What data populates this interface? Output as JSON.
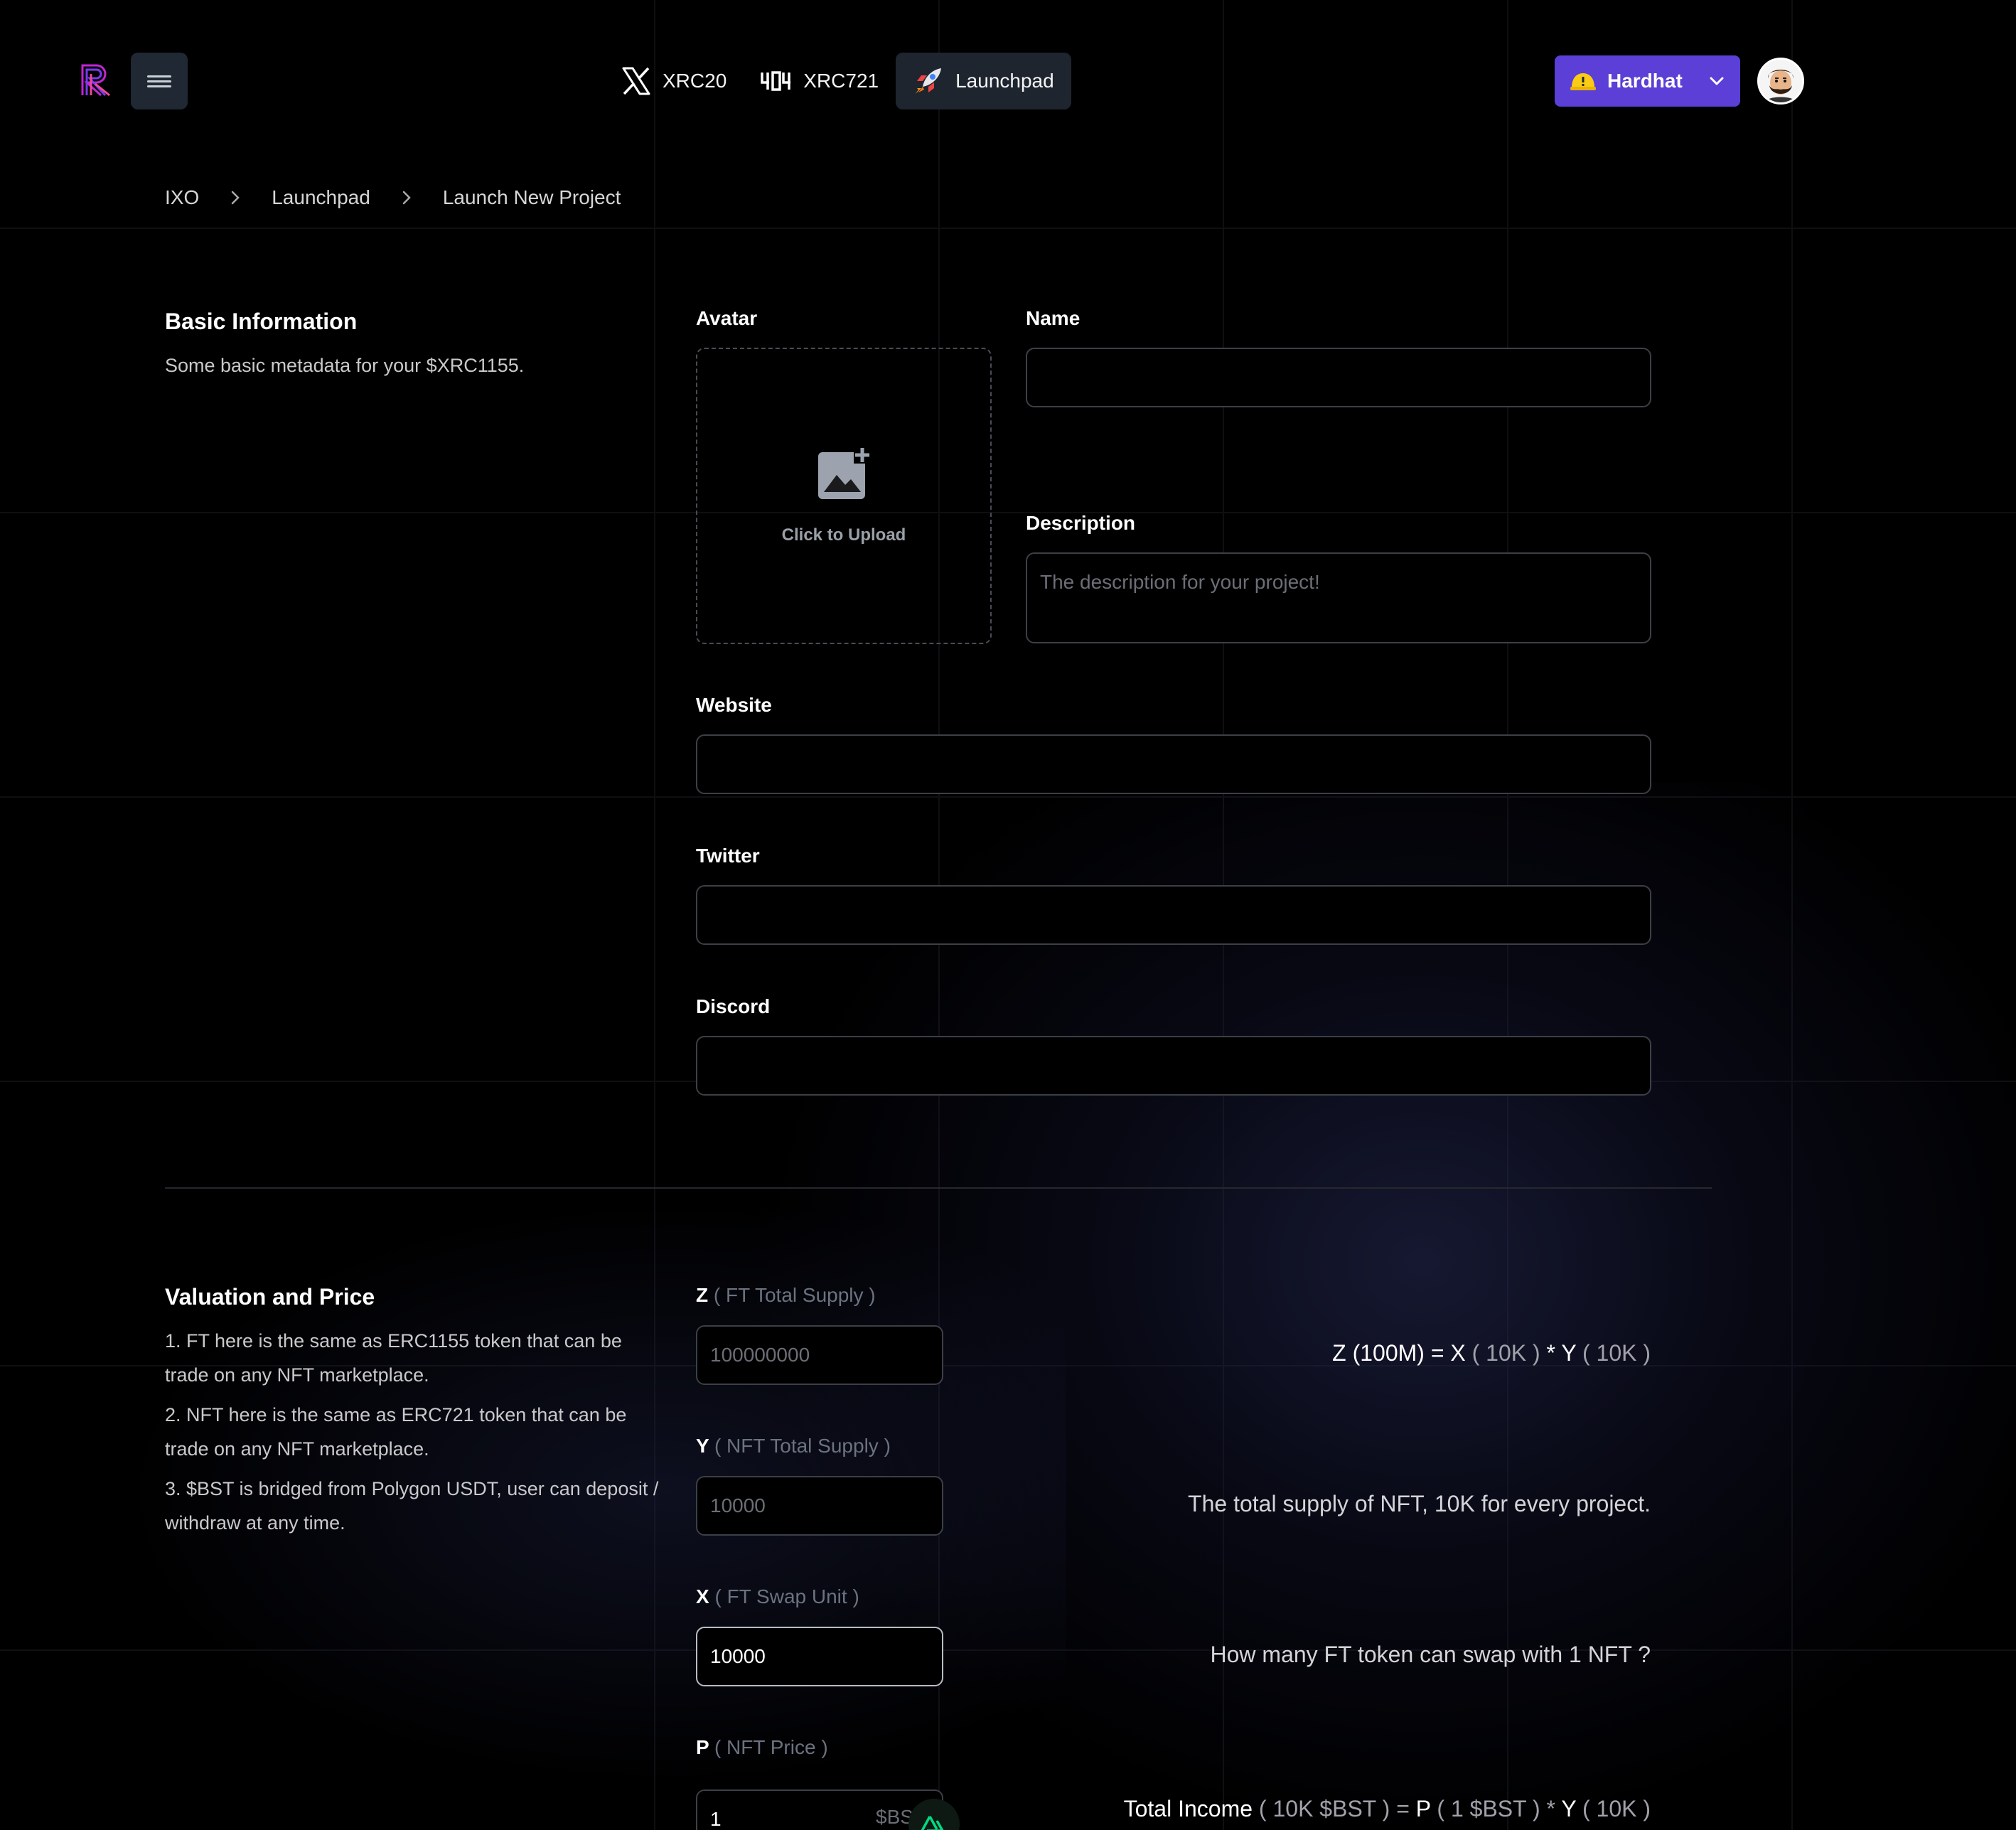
{
  "header": {
    "nav": [
      {
        "label": "XRC20",
        "icon": "x-icon"
      },
      {
        "label": "XRC721",
        "icon": "404-icon"
      },
      {
        "label": "Launchpad",
        "icon": "rocket-icon"
      }
    ],
    "network_button": {
      "label": "Hardhat",
      "icon": "hardhat-warning-icon"
    }
  },
  "breadcrumb": [
    "IXO",
    "Launchpad",
    "Launch New Project"
  ],
  "basic_info": {
    "title": "Basic Information",
    "description": "Some basic metadata for your $XRC1155.",
    "avatar_label": "Avatar",
    "upload_text": "Click to Upload",
    "name_label": "Name",
    "name_value": "",
    "description_label": "Description",
    "description_placeholder": "The description for your project!",
    "website_label": "Website",
    "twitter_label": "Twitter",
    "discord_label": "Discord"
  },
  "valuation": {
    "title": "Valuation and Price",
    "notes": [
      "1. FT here is the same as ERC1155 token that can be trade on any NFT marketplace.",
      "2. NFT here is the same as ERC721 token that can be trade on any NFT marketplace.",
      "3. $BST is bridged from Polygon USDT, user can deposit / withdraw at any time."
    ],
    "z": {
      "letter": "Z",
      "sub": "( FT Total Supply )",
      "placeholder": "100000000"
    },
    "y": {
      "letter": "Y",
      "sub": "( NFT Total Supply )",
      "placeholder": "10000"
    },
    "x": {
      "letter": "X",
      "sub": "( FT Swap Unit )",
      "value": "10000"
    },
    "p": {
      "letter": "P",
      "sub": "( NFT Price )",
      "value": "1",
      "suffix": "$BST"
    },
    "formula_z": {
      "a": "Z (100M) = X",
      "b": "( 10K )",
      "c": "* Y",
      "d": "( 10K )"
    },
    "formula_y": "The total supply of NFT, 10K for every project.",
    "formula_x": "How many FT token can swap with 1 NFT ?",
    "formula_p": {
      "a": "Total Income",
      "b": "( 10K $BST ) =",
      "c": "P",
      "d": "( 1 $BST ) *",
      "e": "Y",
      "f": "( 10K )"
    }
  }
}
